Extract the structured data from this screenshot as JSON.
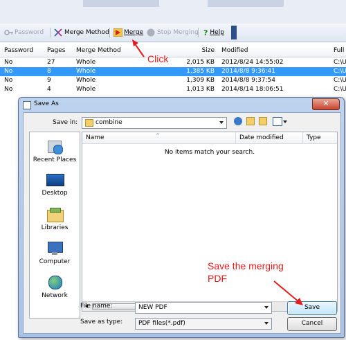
{
  "toolbar": {
    "password_label": "Password",
    "merge_method_label": "Merge Method",
    "merge_label": "Merge",
    "stop_merging_label": "Stop Merging",
    "help_label": "Help"
  },
  "grid": {
    "columns": [
      "Password",
      "Pages",
      "Merge Method",
      "Size",
      "Modified",
      "Full f"
    ],
    "rows": [
      {
        "password": "No",
        "pages": "27",
        "method": "Whole",
        "size": "2,015 KB",
        "modified": "2012/8/24 14:55:02",
        "path": "C:\\U",
        "selected": false
      },
      {
        "password": "No",
        "pages": "8",
        "method": "Whole",
        "size": "1,385 KB",
        "modified": "2014/8/8 9:36:41",
        "path": "C:\\U",
        "selected": true
      },
      {
        "password": "No",
        "pages": "9",
        "method": "Whole",
        "size": "1,309 KB",
        "modified": "2014/8/8 9:37:54",
        "path": "C:\\U",
        "selected": false
      },
      {
        "password": "No",
        "pages": "4",
        "method": "Whole",
        "size": "1,013 KB",
        "modified": "2014/8/14 18:06:51",
        "path": "C:\\U",
        "selected": false
      }
    ]
  },
  "annotations": {
    "click": "Click",
    "save_line1": "Save the merging",
    "save_line2": "PDF"
  },
  "dialog": {
    "title": "Save As",
    "close_symbol": "✕",
    "save_in_label": "Save in:",
    "save_in_value": "combine",
    "places": [
      "Recent Places",
      "Desktop",
      "Libraries",
      "Computer",
      "Network"
    ],
    "columns": [
      "Name",
      "Date modified",
      "Type"
    ],
    "empty_message": "No items match your search.",
    "file_name_label": "File name:",
    "file_name_value": "NEW PDF",
    "save_as_type_label": "Save as type:",
    "save_as_type_value": "PDF files(*.pdf)",
    "save_button": "Save",
    "cancel_button": "Cancel"
  },
  "colors": {
    "selection": "#3399ff",
    "annotation": "#e41c1c",
    "dialog_frame": "#bed3ee"
  }
}
